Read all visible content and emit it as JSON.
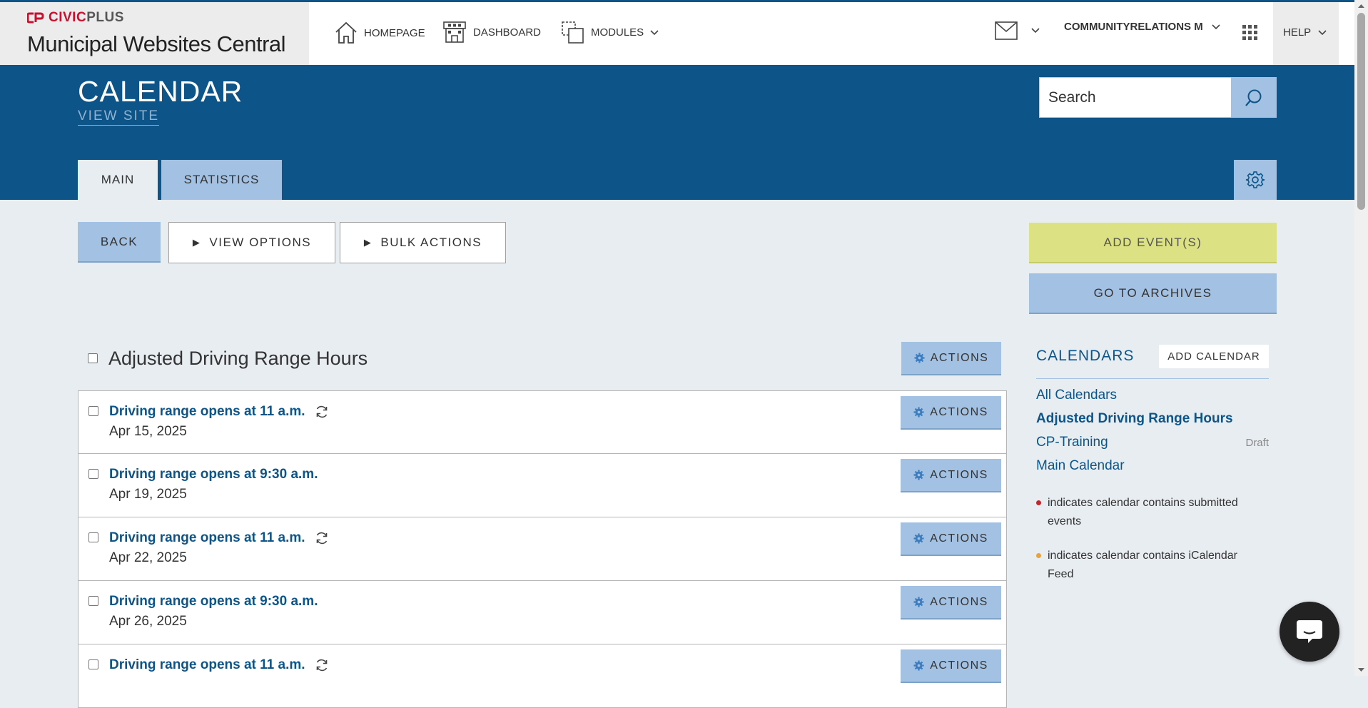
{
  "brand": {
    "logo_text_civic": "CIVIC",
    "logo_text_plus": "PLUS",
    "title": "Municipal Websites Central"
  },
  "nav": {
    "homepage": "HOMEPAGE",
    "dashboard": "DASHBOARD",
    "modules": "MODULES",
    "user": "COMMUNITYRELATIONS M",
    "help": "HELP"
  },
  "header": {
    "title": "CALENDAR",
    "view_site": "VIEW SITE",
    "search_placeholder": "Search"
  },
  "tabs": [
    {
      "label": "MAIN"
    },
    {
      "label": "STATISTICS"
    }
  ],
  "toolbar": {
    "back": "BACK",
    "view_options": "VIEW OPTIONS",
    "bulk_actions": "BULK ACTIONS",
    "add_events": "ADD EVENT(S)",
    "go_to_archives": "GO TO ARCHIVES"
  },
  "group": {
    "title": "Adjusted Driving Range Hours",
    "actions": "ACTIONS"
  },
  "events": [
    {
      "title": "Driving range opens at 11 a.m.",
      "date": "Apr 15, 2025",
      "recurring": true,
      "actions": "ACTIONS"
    },
    {
      "title": "Driving range opens at 9:30 a.m.",
      "date": "Apr 19, 2025",
      "recurring": false,
      "actions": "ACTIONS"
    },
    {
      "title": "Driving range opens at 11 a.m.",
      "date": "Apr 22, 2025",
      "recurring": true,
      "actions": "ACTIONS"
    },
    {
      "title": "Driving range opens at 9:30 a.m.",
      "date": "Apr 26, 2025",
      "recurring": false,
      "actions": "ACTIONS"
    },
    {
      "title": "Driving range opens at 11 a.m.",
      "date": "",
      "recurring": true,
      "actions": "ACTIONS"
    }
  ],
  "sidebar": {
    "heading": "CALENDARS",
    "add_calendar": "ADD CALENDAR",
    "calendars": [
      {
        "label": "All Calendars",
        "active": false,
        "status": ""
      },
      {
        "label": "Adjusted Driving Range Hours",
        "active": true,
        "status": ""
      },
      {
        "label": "CP-Training",
        "active": false,
        "status": "Draft"
      },
      {
        "label": "Main Calendar",
        "active": false,
        "status": ""
      }
    ],
    "legend": [
      {
        "text": "indicates calendar contains submitted events",
        "color": "#c0282d"
      },
      {
        "text": "indicates calendar contains iCalendar Feed",
        "color": "#e8a33a"
      }
    ]
  },
  "colors": {
    "primary": "#0d5588",
    "button_blue": "#a3c1e2",
    "button_yellow": "#dce284",
    "brand_red": "#c41230"
  }
}
